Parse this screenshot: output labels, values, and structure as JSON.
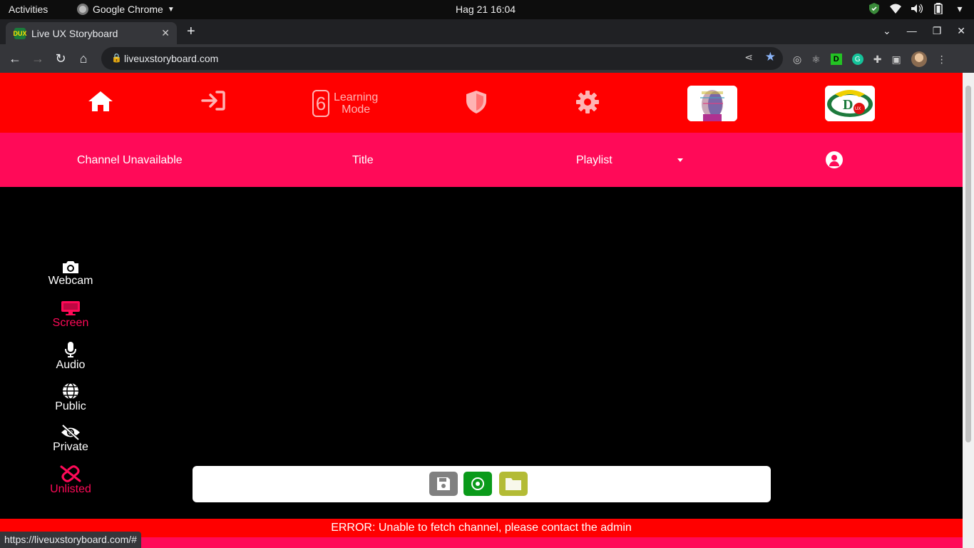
{
  "os": {
    "activities": "Activities",
    "app_name": "Google Chrome",
    "clock": "Hag 21  16:04"
  },
  "browser": {
    "tab_title": "Live UX Storyboard",
    "tab_favicon": "DUX",
    "url": "liveuxstoryboard.com",
    "status_url": "https://liveuxstoryboard.com/#"
  },
  "app": {
    "learning_mode_number": "6",
    "learning_mode_label_1": "Learning",
    "learning_mode_label_2": "Mode",
    "channel": "Channel Unavailable",
    "title": "Title",
    "playlist": "Playlist",
    "side_items": [
      {
        "label": "Webcam",
        "icon": "camera-icon"
      },
      {
        "label": "Screen",
        "icon": "desktop-icon"
      },
      {
        "label": "Audio",
        "icon": "microphone-icon"
      },
      {
        "label": "Public",
        "icon": "globe-icon"
      },
      {
        "label": "Private",
        "icon": "eye-slash-icon"
      },
      {
        "label": "Unlisted",
        "icon": "unlink-icon"
      }
    ],
    "error": "ERROR: Unable to fetch channel, please contact the admin"
  },
  "colors": {
    "header_red": "#ff0000",
    "header_pink": "#ff0a58",
    "save_gray": "#808080",
    "record_green": "#0a9a1a",
    "folder_olive": "#b3bb35"
  }
}
